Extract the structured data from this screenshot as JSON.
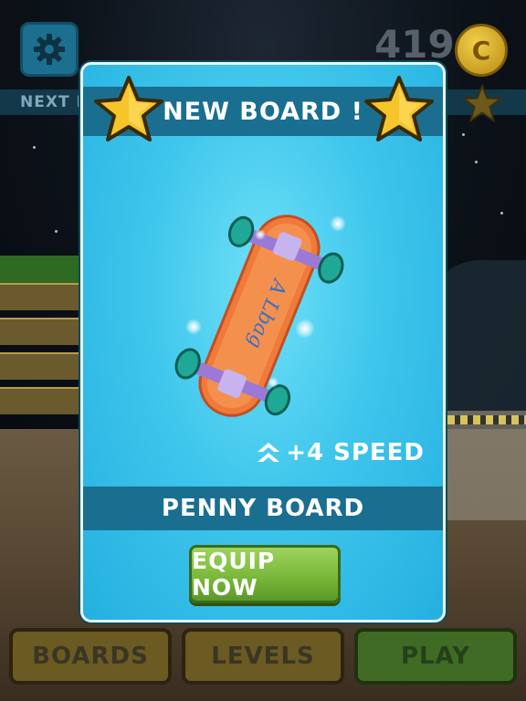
{
  "hud": {
    "next_board_label": "NEXT B",
    "coins": "419",
    "coin_symbol": "C",
    "settings_icon": "gear-icon"
  },
  "popup": {
    "title": "NEW BOARD !",
    "speed_bonus": "+4 SPEED",
    "board_name": "PENNY BOARD",
    "equip_label": "EQUIP NOW",
    "board_deck_text": "A Lbag"
  },
  "bottom_nav": {
    "boards": "BOARDS",
    "levels": "LEVELS",
    "play": "PLAY"
  },
  "colors": {
    "popup_bg": "#3fc6ec",
    "header_bar": "#1a6f91",
    "equip_green": "#79b93a",
    "star_gold": "#f5c52a"
  }
}
